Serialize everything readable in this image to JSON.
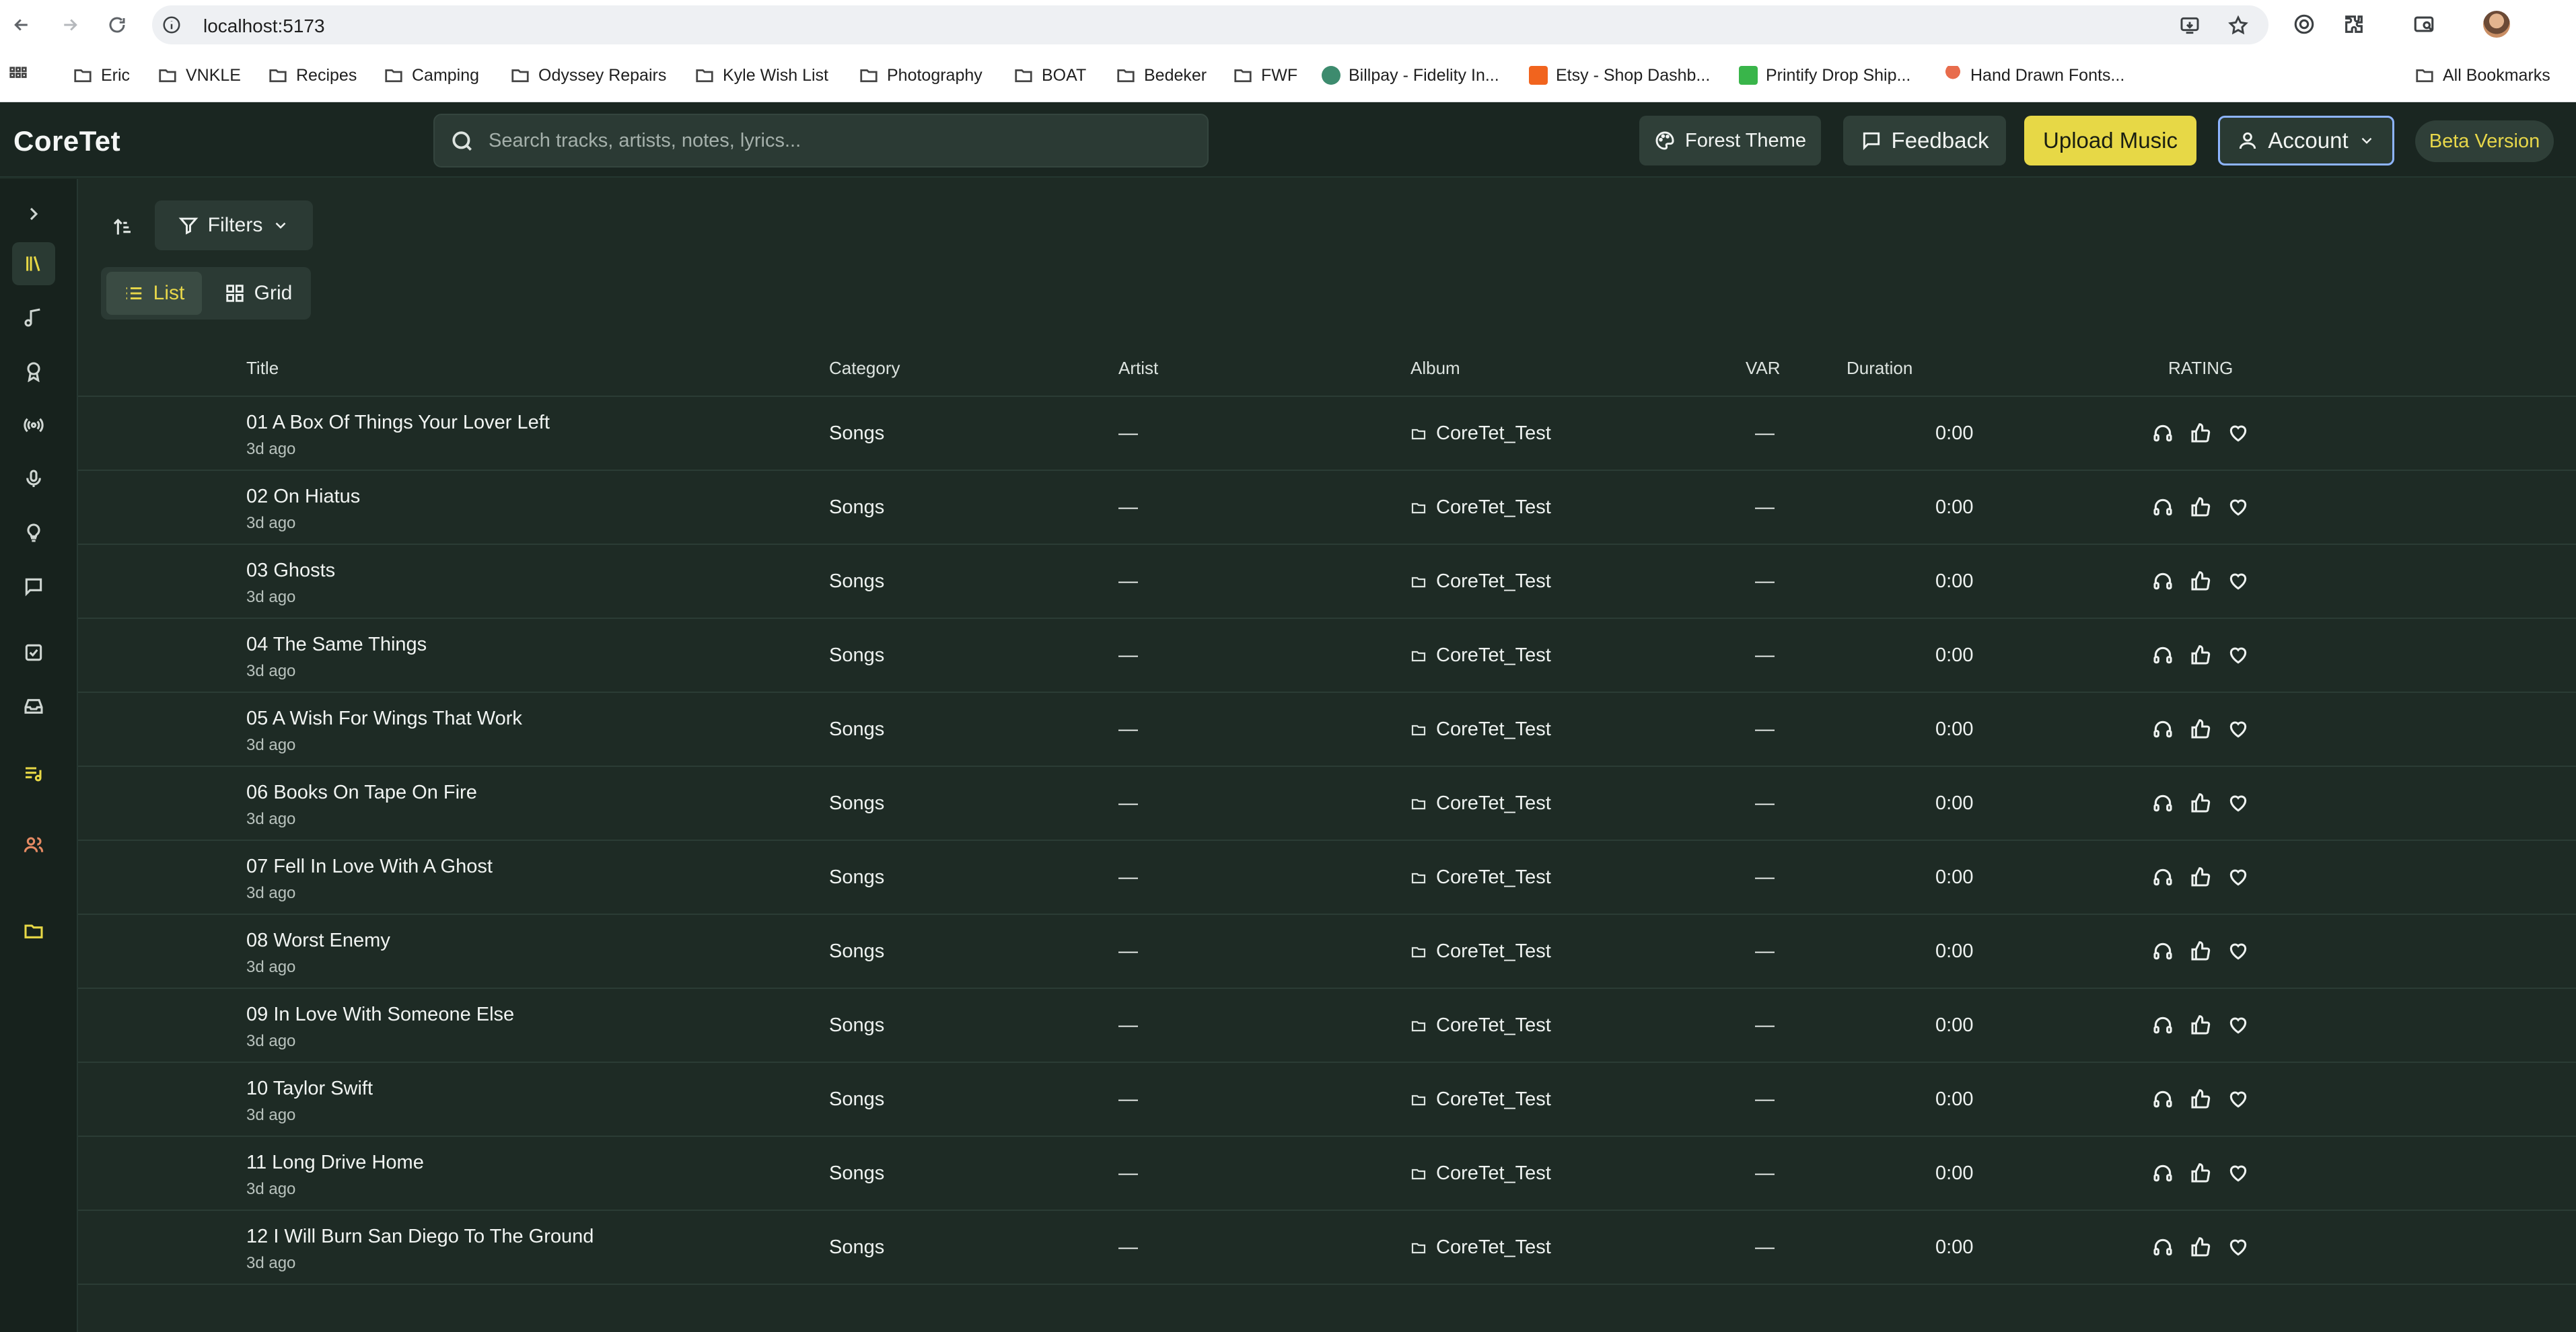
{
  "browser": {
    "url": "localhost:5173",
    "bookmarks": [
      {
        "label": "Eric",
        "icon": "folder-icon"
      },
      {
        "label": "VNKLE",
        "icon": "folder-icon"
      },
      {
        "label": "Recipes",
        "icon": "folder-icon"
      },
      {
        "label": "Camping",
        "icon": "folder-icon"
      },
      {
        "label": "Odyssey Repairs",
        "icon": "folder-icon"
      },
      {
        "label": "Kyle Wish List",
        "icon": "folder-icon"
      },
      {
        "label": "Photography",
        "icon": "folder-icon"
      },
      {
        "label": "BOAT",
        "icon": "folder-icon"
      },
      {
        "label": "Bedeker",
        "icon": "folder-icon"
      },
      {
        "label": "FWF",
        "icon": "folder-icon"
      },
      {
        "label": "Billpay - Fidelity In...",
        "icon": "fidelity-favicon"
      },
      {
        "label": "Etsy - Shop Dashb...",
        "icon": "etsy-favicon"
      },
      {
        "label": "Printify Drop Ship...",
        "icon": "printify-favicon"
      },
      {
        "label": "Hand Drawn Fonts...",
        "icon": "palm-favicon"
      }
    ],
    "all_bookmarks": "All Bookmarks"
  },
  "header": {
    "logo": "CoreTet",
    "search_placeholder": "Search tracks, artists, notes, lyrics...",
    "theme_label": "Forest Theme",
    "feedback_label": "Feedback",
    "upload_label": "Upload Music",
    "account_label": "Account",
    "beta_label": "Beta Version"
  },
  "toolbar": {
    "filters_label": "Filters",
    "list_label": "List",
    "grid_label": "Grid"
  },
  "table": {
    "columns": {
      "title": "Title",
      "category": "Category",
      "artist": "Artist",
      "album": "Album",
      "var": "VAR",
      "duration": "Duration",
      "rating": "RATING"
    },
    "rows": [
      {
        "title": "01 A Box Of Things Your Lover Left",
        "ago": "3d ago",
        "category": "Songs",
        "artist": "—",
        "album": "CoreTet_Test",
        "var": "—",
        "duration": "0:00"
      },
      {
        "title": "02 On Hiatus",
        "ago": "3d ago",
        "category": "Songs",
        "artist": "—",
        "album": "CoreTet_Test",
        "var": "—",
        "duration": "0:00"
      },
      {
        "title": "03 Ghosts",
        "ago": "3d ago",
        "category": "Songs",
        "artist": "—",
        "album": "CoreTet_Test",
        "var": "—",
        "duration": "0:00"
      },
      {
        "title": "04 The Same Things",
        "ago": "3d ago",
        "category": "Songs",
        "artist": "—",
        "album": "CoreTet_Test",
        "var": "—",
        "duration": "0:00"
      },
      {
        "title": "05 A Wish For Wings That Work",
        "ago": "3d ago",
        "category": "Songs",
        "artist": "—",
        "album": "CoreTet_Test",
        "var": "—",
        "duration": "0:00"
      },
      {
        "title": "06 Books On Tape On Fire",
        "ago": "3d ago",
        "category": "Songs",
        "artist": "—",
        "album": "CoreTet_Test",
        "var": "—",
        "duration": "0:00"
      },
      {
        "title": "07 Fell In Love With A Ghost",
        "ago": "3d ago",
        "category": "Songs",
        "artist": "—",
        "album": "CoreTet_Test",
        "var": "—",
        "duration": "0:00"
      },
      {
        "title": "08 Worst Enemy",
        "ago": "3d ago",
        "category": "Songs",
        "artist": "—",
        "album": "CoreTet_Test",
        "var": "—",
        "duration": "0:00"
      },
      {
        "title": "09 In Love With Someone Else",
        "ago": "3d ago",
        "category": "Songs",
        "artist": "—",
        "album": "CoreTet_Test",
        "var": "—",
        "duration": "0:00"
      },
      {
        "title": "10 Taylor Swift",
        "ago": "3d ago",
        "category": "Songs",
        "artist": "—",
        "album": "CoreTet_Test",
        "var": "—",
        "duration": "0:00"
      },
      {
        "title": "11 Long Drive Home",
        "ago": "3d ago",
        "category": "Songs",
        "artist": "—",
        "album": "CoreTet_Test",
        "var": "—",
        "duration": "0:00"
      },
      {
        "title": "12 I Will Burn San Diego To The Ground",
        "ago": "3d ago",
        "category": "Songs",
        "artist": "—",
        "album": "CoreTet_Test",
        "var": "—",
        "duration": "0:00"
      }
    ]
  },
  "colors": {
    "background": "#1e2b25",
    "accent_yellow": "#e7d846",
    "accent_orange": "#e58a63",
    "focus_blue": "#8db4ff"
  }
}
